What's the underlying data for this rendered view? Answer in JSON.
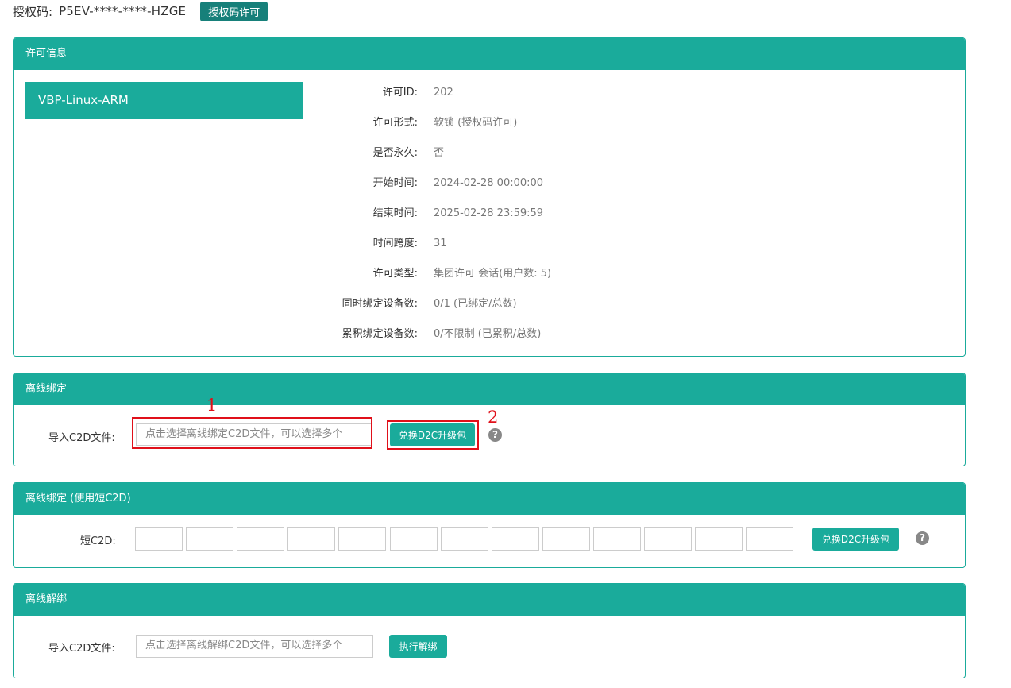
{
  "topbar": {
    "label": "授权码:",
    "code": "P5EV-****-****-HZGE",
    "button": "授权码许可"
  },
  "license_panel": {
    "title": "许可信息",
    "product": "VBP-Linux-ARM",
    "rows": [
      {
        "key": "许可ID:",
        "value": "202"
      },
      {
        "key": "许可形式:",
        "value": "软锁 (授权码许可)"
      },
      {
        "key": "是否永久:",
        "value": "否"
      },
      {
        "key": "开始时间:",
        "value": "2024-02-28 00:00:00"
      },
      {
        "key": "结束时间:",
        "value": "2025-02-28 23:59:59"
      },
      {
        "key": "时间跨度:",
        "value": "31"
      },
      {
        "key": "许可类型:",
        "value": "集团许可 会话(用户数: 5)"
      },
      {
        "key": "同时绑定设备数:",
        "value": "0/1 (已绑定/总数)"
      },
      {
        "key": "累积绑定设备数:",
        "value": "0/不限制 (已累积/总数)"
      }
    ]
  },
  "offline_bind": {
    "title": "离线绑定",
    "label": "导入C2D文件:",
    "placeholder": "点击选择离线绑定C2D文件，可以选择多个",
    "button": "兑换D2C升级包",
    "help": "?",
    "annotation_1": "1",
    "annotation_2": "2"
  },
  "offline_bind_short": {
    "title": "离线绑定 (使用短C2D)",
    "label": "短C2D:",
    "segments": [
      "",
      "",
      "",
      "",
      "",
      "",
      "",
      "",
      "",
      "",
      "",
      "",
      ""
    ],
    "button": "兑换D2C升级包",
    "help": "?"
  },
  "offline_unbind": {
    "title": "离线解绑",
    "label": "导入C2D文件:",
    "placeholder": "点击选择离线解绑C2D文件，可以选择多个",
    "button": "执行解绑"
  },
  "colors": {
    "accent": "#1aab9b",
    "accent_dark": "#17807a",
    "annotation": "#e0101a"
  }
}
